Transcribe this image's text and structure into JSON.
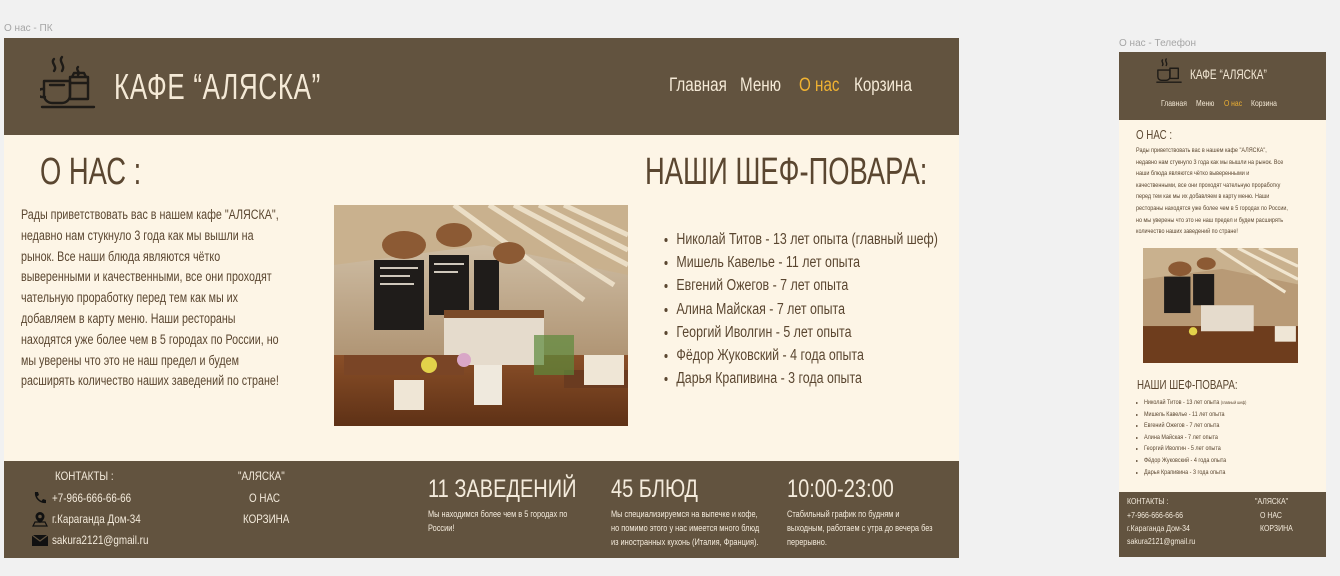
{
  "frames": {
    "desktop_label": "О нас - ПК",
    "mobile_label": "О нас - Телефон"
  },
  "site": {
    "title": "КАФЕ “АЛЯСКА”"
  },
  "nav": [
    "Главная",
    "Меню",
    "О нас",
    "Корзина"
  ],
  "about": {
    "heading": "О НАС :",
    "lines": [
      "Рады приветствовать вас в нашем кафе \"АЛЯСКА\",",
      "недавно нам стукнуло 3 года как мы вышли на",
      "рынок. Все наши блюда являются чётко",
      "выверенными и качественными, все они проходят",
      "чательную проработку перед тем как мы их",
      "добавляем в карту меню. Наши рестораны",
      "находятся уже более чем в 5 городах по России, но",
      "мы уверены что это не наш предел и будем",
      "расширять количество наших заведений по стране!"
    ]
  },
  "chefs": {
    "heading": "НАШИ ШЕФ-ПОВАРА:",
    "items": [
      "Николай Титов - 13 лет опыта (главный шеф)",
      "Мишель Кавелье - 11 лет опыта",
      "Евгений Ожегов - 7 лет опыта",
      "Алина Майская - 7 лет опыта",
      "Георгий Иволгин - 5 лет опыта",
      "Фёдор Жуковский - 4 года опыта",
      "Дарья Крапивина - 3 года опыта"
    ],
    "mobile_first": "Николай Титов - 13 лет опыта ",
    "mobile_first_note": "(главный шеф)"
  },
  "footer": {
    "contacts_heading": "КОНТАКТЫ :",
    "phone": "+7-966-666-66-66",
    "address": "г.Караганда Дом-34",
    "email": "sakura2121@gmail.ru",
    "brand": "\"АЛЯСКА\"",
    "links": [
      "О НАС",
      "КОРЗИНА"
    ],
    "stats": [
      {
        "title": "11 ЗАВЕДЕНИЙ",
        "lines": [
          "Мы находимся более чем в 5 городах по",
          "России!"
        ]
      },
      {
        "title": "45 БЛЮД",
        "lines": [
          "Мы специализируемся на выпечке и кофе,",
          "но помимо этого у нас имеется много блюд",
          "из иностранных кухонь (Италия, Франция)."
        ]
      },
      {
        "title": "10:00-23:00",
        "lines": [
          "Стабильный график по будням и",
          "выходным, работаем с утра до вечера без",
          "перерывно."
        ]
      }
    ]
  },
  "mobile": {
    "about_lines": [
      "Рады приветствовать вас в нашем кафе \"АЛЯСКА\",",
      "недавно нам стукнуло 3 года как мы вышли на рынок. Все",
      "наши блюда являются чётко выверенными и",
      "качественными, все они проходят чательную проработку",
      "перед тем как мы их добавляем в карту меню. Наши",
      "рестораны находятся уже более чем в 5 городах по России,",
      "но мы уверены что это не наш предел и будем расширять",
      "количество наших заведений по стране!"
    ]
  },
  "colors": {
    "brown": "#62533f",
    "cream": "#fdf5e6",
    "accent": "#f0b232",
    "text": "#5a4630"
  }
}
